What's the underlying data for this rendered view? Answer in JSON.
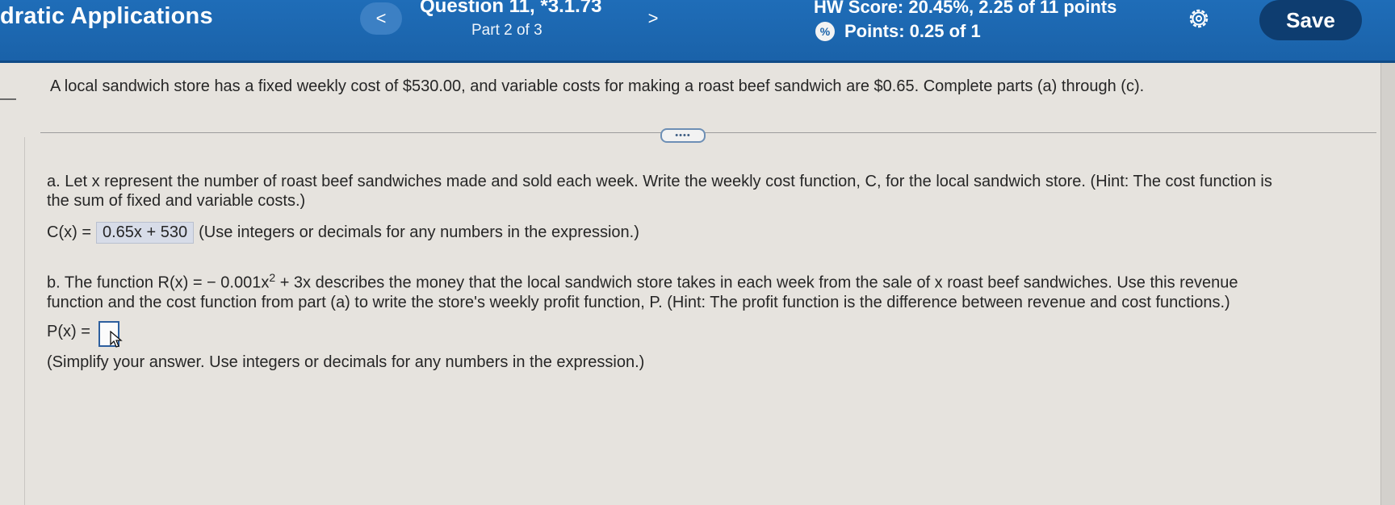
{
  "header": {
    "app_title": "dratic Applications",
    "prev_label": "<",
    "next_label": ">",
    "question_title": "Question 11, *3.1.73",
    "question_part": "Part 2 of 3",
    "hw_score": "HW Score: 20.45%, 2.25 of 11 points",
    "points": "Points: 0.25 of 1",
    "save_label": "Save"
  },
  "problem": {
    "intro": "A local sandwich store has a fixed weekly cost of $530.00, and variable costs for making a roast beef sandwich are $0.65. Complete parts (a) through (c).",
    "ellipsis": "••••"
  },
  "part_a": {
    "line1": "a. Let x represent the number of roast beef sandwiches made and sold each week. Write the weekly cost function, C, for the local sandwich store. (Hint: The cost function is",
    "line2": "the sum of fixed and variable costs.)",
    "label": "C(x) =",
    "answer": "0.65x + 530",
    "note": "(Use integers or decimals for any numbers in the expression.)"
  },
  "part_b": {
    "line1_pre": "b. The function R(x) = − 0.001x",
    "line1_sup": "2",
    "line1_post": " + 3x describes the money that the local sandwich store takes in each week from the sale of x roast beef sandwiches. Use this revenue",
    "line2": "function and the cost function from part (a) to write the store's weekly profit function, P. (Hint: The profit function is the difference between revenue and cost functions.)",
    "label": "P(x) =",
    "note": "(Simplify your answer. Use integers or decimals for any numbers in the expression.)"
  },
  "colors": {
    "header_blue": "#1a62a9",
    "save_button": "#0e3d70",
    "answer_highlight": "#d7dce8",
    "background": "#e6e3de"
  }
}
